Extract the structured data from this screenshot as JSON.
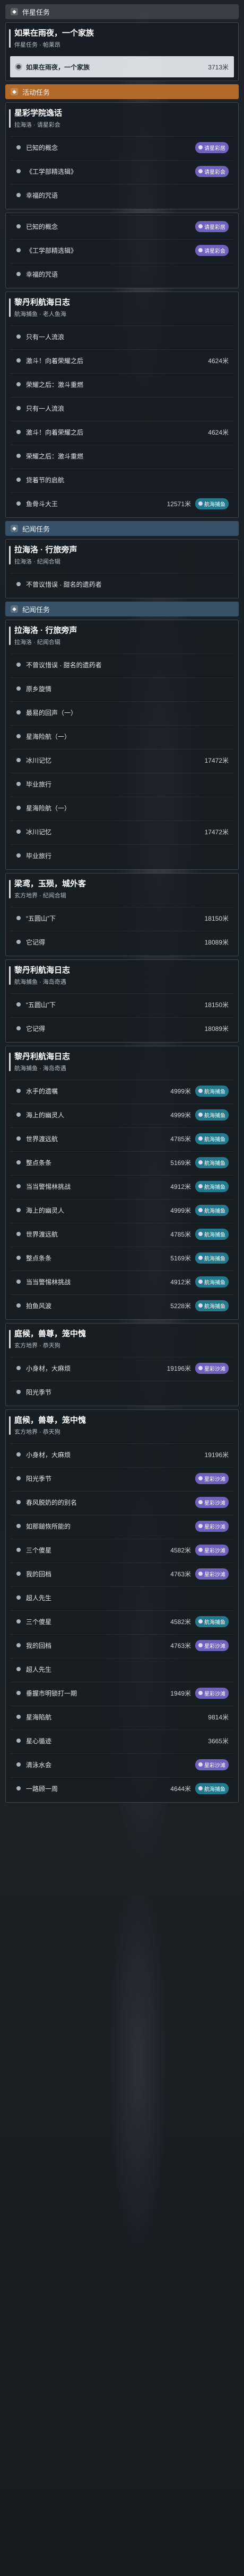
{
  "sections": [
    {
      "title": "伴星任务",
      "style": "gray",
      "icon": "star-icon",
      "quests": [
        {
          "title": "如果在雨夜，一个家族",
          "subtitle": "伴星任务 · 帕莱昂",
          "open": true,
          "steps": [
            {
              "label": "如果在雨夜，一个家族",
              "distance": "3713米",
              "highlight": true
            }
          ]
        }
      ]
    },
    {
      "title": "活动任务",
      "style": "orange",
      "icon": "flag-icon",
      "quests": [
        {
          "title": "星彩学院逸话",
          "subtitle": "拉海洛 · 请星彩会",
          "open": true,
          "steps": [
            {
              "label": "已知的概念",
              "badge": "请星彩居"
            },
            {
              "label": "《工学部精选辑》",
              "badge": "请星彩会"
            },
            {
              "label": "幸福的咒语",
              "badge": ""
            }
          ]
        },
        {
          "title": "",
          "subtitle": "",
          "open": true,
          "steps": [
            {
              "label": "已知的概念",
              "badge": "请星彩居"
            },
            {
              "label": "《工学部精选辑》",
              "badge": "请星彩会"
            },
            {
              "label": "幸福的咒语",
              "badge": ""
            }
          ]
        },
        {
          "title": "黎丹利航海日志",
          "subtitle": "航海捕鱼 · 老人鱼海",
          "open": true,
          "steps": [
            {
              "label": "只有一人流浪",
              "badge": ""
            },
            {
              "label": "激斗！向着荣耀之后",
              "distance": "4624米"
            },
            {
              "label": "荣耀之后：激斗重燃",
              "badge": ""
            },
            {
              "label": "只有一人流浪",
              "badge": ""
            },
            {
              "label": "激斗！向着荣耀之后",
              "distance": "4624米"
            },
            {
              "label": "荣耀之后：激斗重燃",
              "badge": ""
            },
            {
              "label": "贷着节的启航",
              "badge": ""
            },
            {
              "label": "鱼骨斗大王",
              "distance": "12571米",
              "badge": "航海捕鱼"
            }
          ]
        }
      ]
    },
    {
      "title": "纪闻任务",
      "style": "blue",
      "icon": "book-icon",
      "quests": [
        {
          "title": "拉海洛 · 行旅旁声",
          "subtitle": "拉海洛 · 纪闻合辑",
          "open": true,
          "steps": [
            {
              "label": "不曾议惜误 · 甜名的遗药者",
              "badge": ""
            }
          ]
        }
      ]
    },
    {
      "title": "纪闻任务",
      "style": "blue",
      "icon": "book-icon",
      "quests": [
        {
          "title": "拉海洛 · 行旅旁声",
          "subtitle": "拉海洛 · 纪闻合辑",
          "open": true,
          "steps": [
            {
              "label": "不曾议惜误 · 甜名的遗药者",
              "badge": ""
            },
            {
              "label": "原乡旋情",
              "badge": ""
            },
            {
              "label": "最易的回声（一）",
              "badge": ""
            },
            {
              "label": "星海险航（一）",
              "badge": ""
            },
            {
              "label": "冰川记忆",
              "distance": "17472米"
            },
            {
              "label": "毕业旅行",
              "badge": ""
            },
            {
              "label": "星海险航（一）",
              "badge": ""
            },
            {
              "label": "冰川记忆",
              "distance": "17472米"
            },
            {
              "label": "毕业旅行",
              "badge": ""
            }
          ]
        },
        {
          "title": "梁鸢，玉殒，城外客",
          "subtitle": "玄方地界 · 纪闻合辑",
          "open": true,
          "steps": [
            {
              "label": "“五圆山”下",
              "distance": "18150米"
            },
            {
              "label": "它记得",
              "distance": "18089米"
            }
          ]
        },
        {
          "title": "黎丹利航海日志",
          "subtitle": "航海捕鱼 · 海岛奇遇",
          "open": true,
          "steps": [
            {
              "label": "“五圆山”下",
              "distance": "18150米"
            },
            {
              "label": "它记得",
              "distance": "18089米"
            }
          ]
        },
        {
          "title": "黎丹利航海日志",
          "subtitle": "航海捕鱼 · 海岛奇遇",
          "open": true,
          "steps": [
            {
              "label": "水手的遗嘱",
              "distance": "4999米",
              "badge": "航海捕鱼"
            },
            {
              "label": "海上的幽灵人",
              "distance": "4999米",
              "badge": "航海捕鱼"
            },
            {
              "label": "世界渡远航",
              "distance": "4785米",
              "badge": "航海捕鱼"
            },
            {
              "label": "整点条条",
              "distance": "5169米",
              "badge": "航海捕鱼"
            },
            {
              "label": "当当警惕林挑战",
              "distance": "4912米",
              "badge": "航海捕鱼"
            },
            {
              "label": "海上的幽灵人",
              "distance": "4999米",
              "badge": "航海捕鱼"
            },
            {
              "label": "世界渡远航",
              "distance": "4785米",
              "badge": "航海捕鱼"
            },
            {
              "label": "整点条条",
              "distance": "5169米",
              "badge": "航海捕鱼"
            },
            {
              "label": "当当警惕林挑战",
              "distance": "4912米",
              "badge": "航海捕鱼"
            },
            {
              "label": "拍鱼风波",
              "distance": "5228米",
              "badge": "航海捕鱼"
            }
          ]
        },
        {
          "title": "庭候，兽尊，笼中愧",
          "subtitle": "玄方地界 · 恭天狗",
          "open": true,
          "steps": [
            {
              "label": "小身材，大麻烦",
              "distance": "19196米",
              "badge": "星彩沙滩"
            },
            {
              "label": "阳光季节",
              "badge": ""
            }
          ]
        },
        {
          "title": "庭候，兽尊，笼中愧",
          "subtitle": "玄方地界 · 恭天狗",
          "open": true,
          "steps": [
            {
              "label": "小身材，大麻烦",
              "distance": "19196米",
              "badge": ""
            },
            {
              "label": "阳光季节",
              "badge": "星彩沙滩"
            },
            {
              "label": "春风脱奶的的别名",
              "badge": "星彩沙滩"
            },
            {
              "label": "如那鎚恢所能的",
              "badge": "星彩沙滩"
            },
            {
              "label": "三个傻星",
              "distance": "4582米",
              "badge": "星彩沙滩"
            },
            {
              "label": "我的回档",
              "distance": "4763米",
              "badge": "星彩沙滩"
            },
            {
              "label": "超人先生",
              "badge": ""
            },
            {
              "label": "三个傻星",
              "distance": "4582米",
              "badge": "航海捕鱼"
            },
            {
              "label": "我的回档",
              "distance": "4763米",
              "badge": "星彩沙滩"
            },
            {
              "label": "超人先生",
              "badge": ""
            },
            {
              "label": "垂握市明锁打一期",
              "distance": "1949米",
              "badge": "星彩沙滩"
            },
            {
              "label": "星海陷航",
              "distance": "9814米",
              "badge": ""
            },
            {
              "label": "星心循迹",
              "distance": "3665米",
              "badge": ""
            },
            {
              "label": "清泳水会",
              "badge": "星彩沙滩"
            },
            {
              "label": "一路顾一周",
              "distance": "4644米",
              "badge": "航海捕鱼"
            }
          ]
        }
      ]
    }
  ]
}
